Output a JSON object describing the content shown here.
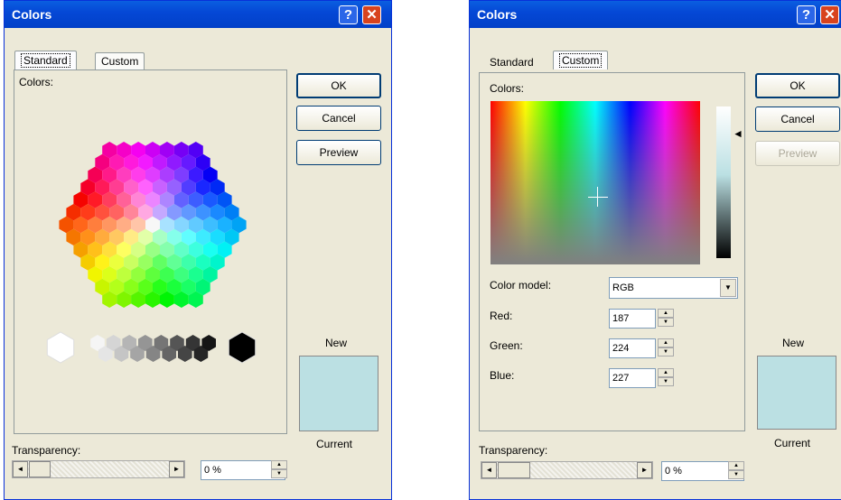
{
  "left": {
    "title": "Colors",
    "tabs": [
      "Standard",
      "Custom"
    ],
    "colors_label": "Colors:",
    "ok": "OK",
    "cancel": "Cancel",
    "preview": "Preview",
    "new_label": "New",
    "current_label": "Current",
    "transparency_label": "Transparency:",
    "transparency_value": "0 %",
    "swatch_color": "#bbe0e3"
  },
  "right": {
    "title": "Colors",
    "tabs": [
      "Standard",
      "Custom"
    ],
    "colors_label": "Colors:",
    "color_model_label": "Color model:",
    "color_model_value": "RGB",
    "red_label": "Red:",
    "red_value": "187",
    "green_label": "Green:",
    "green_value": "224",
    "blue_label": "Blue:",
    "blue_value": "227",
    "ok": "OK",
    "cancel": "Cancel",
    "preview": "Preview",
    "new_label": "New",
    "current_label": "Current",
    "transparency_label": "Transparency:",
    "transparency_value": "0 %",
    "swatch_color": "#bbe0e3"
  },
  "icons": {
    "help": "?",
    "close": "✕",
    "scroll_left": "◄",
    "scroll_right": "►",
    "spin_up": "▲",
    "spin_down": "▼",
    "dropdown": "▼",
    "slider_pointer": "◄"
  }
}
